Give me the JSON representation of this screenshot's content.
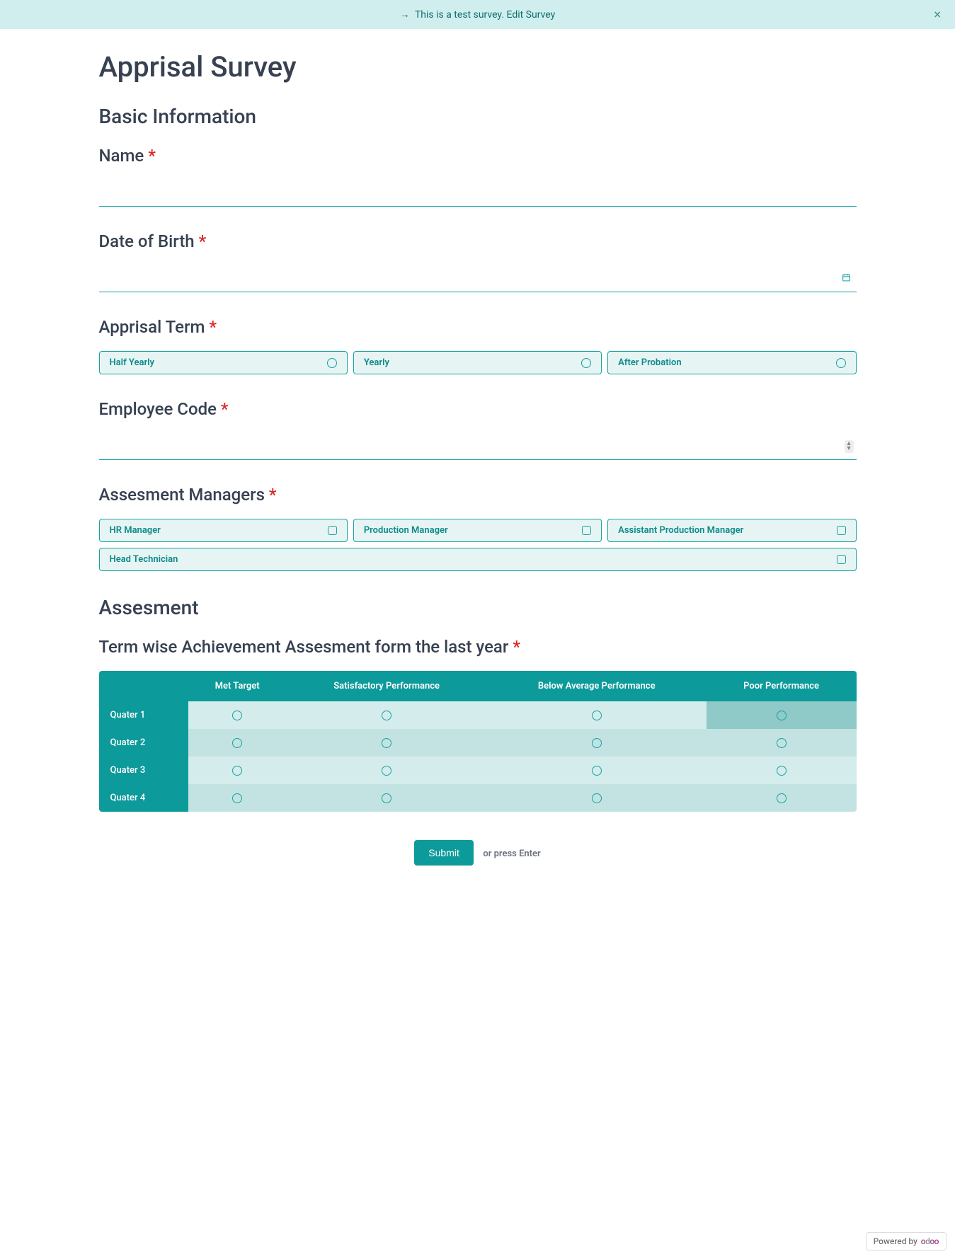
{
  "banner": {
    "text": "This is a test survey. ",
    "link": "Edit Survey"
  },
  "survey": {
    "title": "Apprisal Survey"
  },
  "section_basic": {
    "title": "Basic Information"
  },
  "q_name": {
    "label": "Name "
  },
  "q_dob": {
    "label": "Date of Birth "
  },
  "q_term": {
    "label": "Apprisal Term ",
    "options": [
      "Half Yearly",
      "Yearly",
      "After Probation"
    ]
  },
  "q_code": {
    "label": "Employee Code "
  },
  "q_managers": {
    "label": "Assesment Managers ",
    "options": [
      "HR Manager",
      "Production Manager",
      "Assistant Production Manager",
      "Head Technician"
    ]
  },
  "section_assess": {
    "title": "Assesment"
  },
  "q_matrix": {
    "label": "Term wise Achievement Assesment form the last year ",
    "cols": [
      "Met Target",
      "Satisfactory Performance",
      "Below Average Performance",
      "Poor Performance"
    ],
    "rows": [
      "Quater 1",
      "Quater 2",
      "Quater 3",
      "Quater 4"
    ]
  },
  "submit": {
    "button": "Submit",
    "hint": "or press Enter"
  },
  "powered": {
    "prefix": "Powered by",
    "brand": "odoo"
  }
}
